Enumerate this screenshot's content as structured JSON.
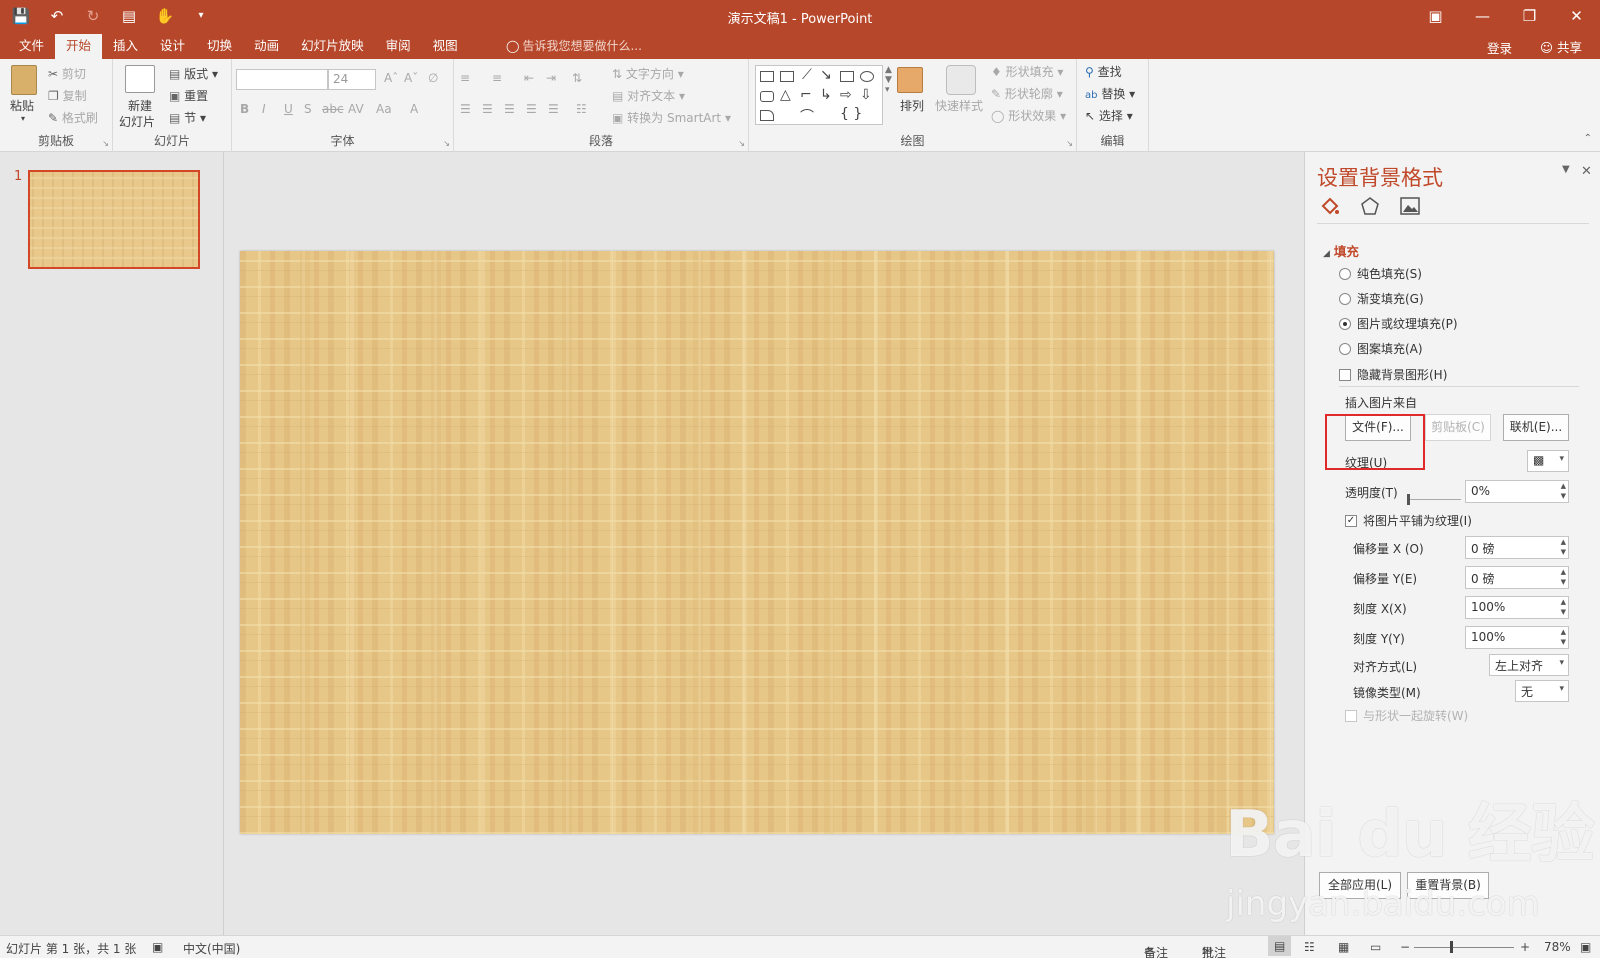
{
  "titlebar": {
    "title": "演示文稿1 - PowerPoint",
    "qat": [
      "save-icon",
      "undo-icon",
      "redo-icon",
      "present-icon",
      "touch-mode-icon",
      "customize-icon"
    ],
    "window_controls": [
      "ribbon-display-icon",
      "minimize-icon",
      "restore-icon",
      "close-icon"
    ]
  },
  "menu": {
    "tabs": [
      "文件",
      "开始",
      "插入",
      "设计",
      "切换",
      "动画",
      "幻灯片放映",
      "审阅",
      "视图"
    ],
    "active": "开始",
    "tell_me": "告诉我您想要做什么...",
    "login": "登录",
    "share": "共享"
  },
  "ribbon": {
    "clipboard": {
      "label": "剪贴板",
      "paste": "粘贴",
      "cut": "剪切",
      "copy": "复制",
      "format_painter": "格式刷"
    },
    "slides": {
      "label": "幻灯片",
      "new_slide_1": "新建",
      "new_slide_2": "幻灯片",
      "layout": "版式",
      "reset": "重置",
      "section": "节"
    },
    "font": {
      "label": "字体",
      "font_name": "",
      "font_size": "24"
    },
    "paragraph": {
      "label": "段落",
      "text_direction": "文字方向",
      "align_text": "对齐文本",
      "smartart": "转换为 SmartArt"
    },
    "drawing": {
      "label": "绘图",
      "arrange": "排列",
      "quick_styles": "快速样式",
      "shape_fill": "形状填充",
      "shape_outline": "形状轮廓",
      "shape_effects": "形状效果"
    },
    "editing": {
      "label": "编辑",
      "find": "查找",
      "replace": "替换",
      "select": "选择"
    }
  },
  "thumbs": {
    "number": "1"
  },
  "pane": {
    "title": "设置背景格式",
    "section": "填充",
    "fill_options": [
      {
        "label": "纯色填充(S)",
        "checked": false
      },
      {
        "label": "渐变填充(G)",
        "checked": false
      },
      {
        "label": "图片或纹理填充(P)",
        "checked": true
      },
      {
        "label": "图案填充(A)",
        "checked": false
      }
    ],
    "hide_bg_graphics": "隐藏背景图形(H)",
    "insert_from": "插入图片来自",
    "file_btn": "文件(F)...",
    "clipboard_btn": "剪贴板(C)",
    "online_btn": "联机(E)...",
    "texture": "纹理(U)",
    "transparency_label": "透明度(T)",
    "transparency": "0%",
    "tile_label": "将图片平铺为纹理(I)",
    "offset_x_label": "偏移量 X (O)",
    "offset_x": "0 磅",
    "offset_y_label": "偏移量 Y(E)",
    "offset_y": "0 磅",
    "scale_x_label": "刻度 X(X)",
    "scale_x": "100%",
    "scale_y_label": "刻度 Y(Y)",
    "scale_y": "100%",
    "align_label": "对齐方式(L)",
    "align": "左上对齐",
    "mirror_label": "镜像类型(M)",
    "mirror": "无",
    "rotate_label": "与形状一起旋转(W)",
    "apply_all": "全部应用(L)",
    "reset_bg": "重置背景(B)"
  },
  "status": {
    "slide_info": "幻灯片 第 1 张，共 1 张",
    "language": "中文(中国)",
    "notes": "备注",
    "comments": "批注",
    "zoom": "78%"
  },
  "watermark": {
    "brand": "Bai du 经验",
    "url": "jingyan.baidu.com"
  },
  "colors": {
    "accent": "#b7472a",
    "slide_texture": "#e6c586",
    "highlight_box": "#e02a2a"
  }
}
